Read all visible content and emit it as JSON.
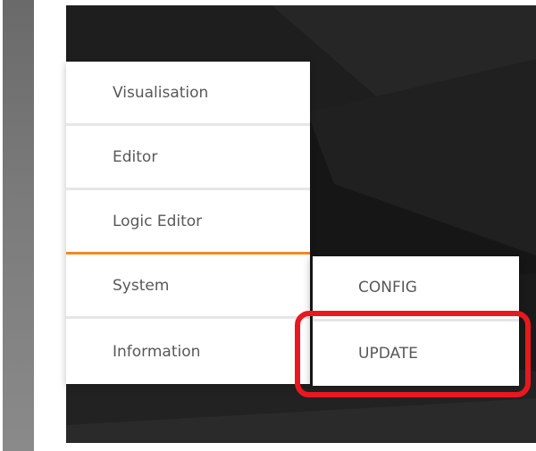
{
  "menu": {
    "items": [
      {
        "label": "Visualisation"
      },
      {
        "label": "Editor"
      },
      {
        "label": "Logic Editor"
      },
      {
        "label": "System"
      },
      {
        "label": "Information"
      }
    ],
    "active_index": 2,
    "active_accent_color": "#ef8a22"
  },
  "submenu": {
    "items": [
      {
        "label": "CONFIG"
      },
      {
        "label": "UPDATE"
      }
    ]
  },
  "annotation": {
    "highlight_color": "#e8181f",
    "highlighted_item": "UPDATE"
  }
}
